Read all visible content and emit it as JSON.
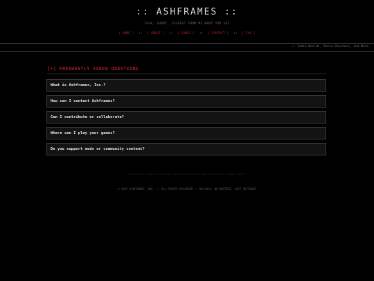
{
  "header": {
    "title": ":: ASHFRAMES ::",
    "tagline": "TALK, SHOUT, ISSUES? FROM ME WHAT YOU GOT"
  },
  "nav": {
    "items": [
      {
        "label": "[ HOME ]"
      },
      {
        "label": "[ ABOUT ]"
      },
      {
        "label": "[ GAMES ]"
      },
      {
        "label": "[ CONTACT ]"
      },
      {
        "label": "[ FAQ ]"
      }
    ],
    "separator": "::"
  },
  "ticker": {
    "text": ":: Indie Worlds, Retro Shooters, and More"
  },
  "faq": {
    "heading": "[+] FREQUENTLY ASKED QUESTIONS",
    "items": [
      {
        "question": "What is Ashframes, Inc.?"
      },
      {
        "question": "How can I contact Ashframes?"
      },
      {
        "question": "Can I contribute or collaborate?"
      },
      {
        "question": "Where can I play your games?"
      },
      {
        "question": "Do you support mods or community content?"
      }
    ]
  },
  "decoration": {
    "line": "=[=]==[=]=-=[=-=-=-=[=]==[=]=[=]==[=]=-=-=[=]==[=]=-=-==[=]==[=]="
  },
  "footer": {
    "text": "© 2025 ASHFRAMES, INC. :: ALL RIGHTS RESERVED :: NO DOGS, NO MASTERS, JUST SOFTWARE"
  },
  "colors": {
    "accent": "#b02020",
    "background": "#000000",
    "item_background": "#131313"
  }
}
